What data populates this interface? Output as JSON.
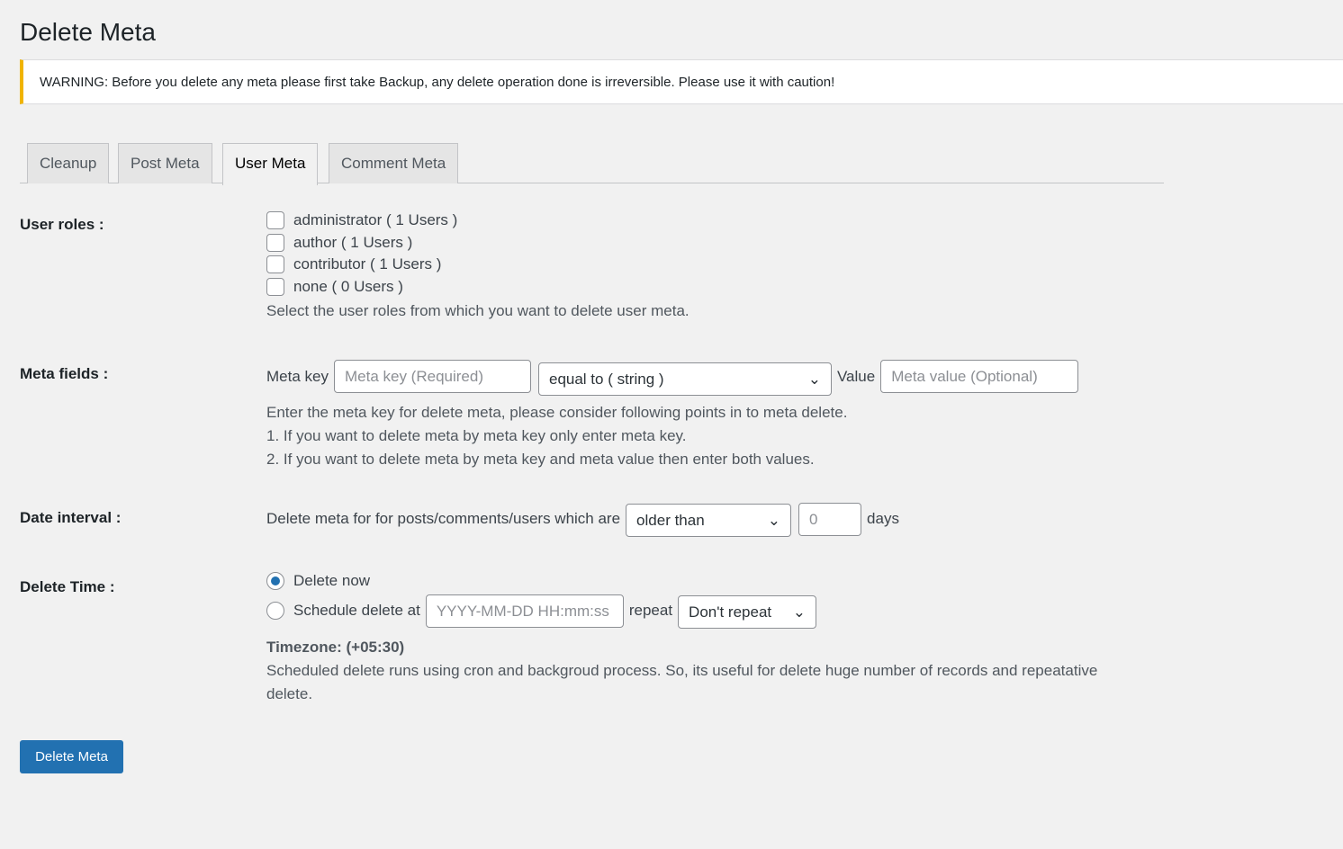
{
  "title": "Delete Meta",
  "warning": "WARNING: Before you delete any meta please first take Backup, any delete operation done is irreversible. Please use it with caution!",
  "tabs": [
    {
      "label": "Cleanup"
    },
    {
      "label": "Post Meta"
    },
    {
      "label": "User Meta",
      "active": true
    },
    {
      "label": "Comment Meta"
    }
  ],
  "user_roles": {
    "label": "User roles :",
    "options": [
      "administrator ( 1 Users )",
      "author ( 1 Users )",
      "contributor ( 1 Users )",
      "none ( 0 Users )"
    ],
    "help": "Select the user roles from which you want to delete user meta."
  },
  "meta_fields": {
    "label": "Meta fields :",
    "key_label": "Meta key",
    "key_placeholder": "Meta key (Required)",
    "operator": "equal to ( string )",
    "value_label": "Value",
    "value_placeholder": "Meta value (Optional)",
    "help": [
      "Enter the meta key for delete meta, please consider following points in to meta delete.",
      "1. If you want to delete meta by meta key only enter meta key.",
      "2. If you want to delete meta by meta key and meta value then enter both values."
    ]
  },
  "date_interval": {
    "label": "Date interval :",
    "text": "Delete meta for for posts/comments/users which are",
    "comparison": "older than",
    "days_value": "0",
    "unit": "days"
  },
  "delete_time": {
    "label": "Delete Time :",
    "now_label": "Delete now",
    "schedule_label": "Schedule delete at",
    "schedule_placeholder": "YYYY-MM-DD HH:mm:ss",
    "repeat_label": "repeat",
    "repeat_value": "Don't repeat",
    "timezone": "Timezone: (+05:30)",
    "help": "Scheduled delete runs using cron and backgroud process. So, its useful for delete huge number of records and repeatative delete.",
    "selected": "now"
  },
  "submit_label": "Delete Meta",
  "colors": {
    "accent": "#2271b1",
    "warning": "#f0b400"
  }
}
